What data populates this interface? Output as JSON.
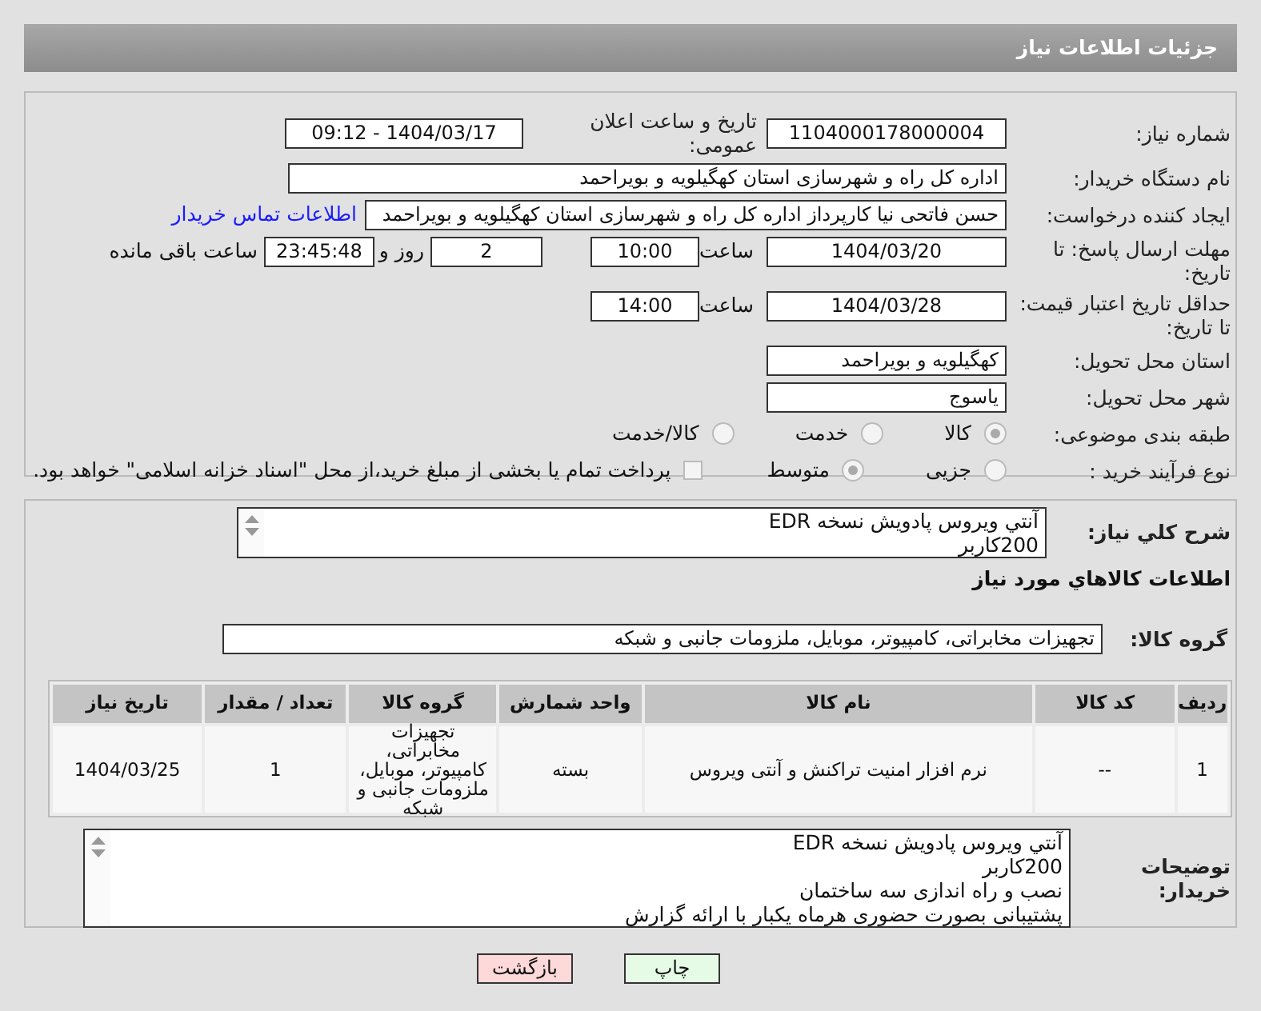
{
  "header": {
    "title": "جزئیات اطلاعات نیاز"
  },
  "need_number": {
    "label": "شماره نیاز:",
    "value": "1104000178000004"
  },
  "announce": {
    "label": "تاریخ و ساعت اعلان عمومی:",
    "value": "1404/03/17 - 09:12"
  },
  "buyer": {
    "label": "نام دستگاه خریدار:",
    "value": "اداره کل راه و شهرسازی استان کهگیلویه و بویراحمد"
  },
  "requester": {
    "label": "ایجاد کننده درخواست:",
    "value": "حسن فاتحی نیا کارپرداز اداره کل راه و شهرسازی استان کهگیلویه و بویراحمد",
    "link": "اطلاعات تماس خریدار"
  },
  "reply_deadline": {
    "label": "مهلت ارسال پاسخ: تا تاریخ:",
    "date": "1404/03/20",
    "time_label": "ساعت",
    "time": "10:00",
    "days": "2",
    "days_label": "روز و",
    "remaining": "23:45:48",
    "remaining_label": "ساعت باقی مانده"
  },
  "price_validity": {
    "label": "حداقل تاریخ اعتبار قیمت: تا تاریخ:",
    "date": "1404/03/28",
    "time_label": "ساعت",
    "time": "14:00"
  },
  "province": {
    "label": "استان محل تحویل:",
    "value": "کهگیلویه و بویراحمد"
  },
  "city": {
    "label": "شهر محل تحویل:",
    "value": "یاسوج"
  },
  "category": {
    "label": "طبقه بندی موضوعی:",
    "options": [
      {
        "label": "کالا",
        "selected": true
      },
      {
        "label": "خدمت",
        "selected": false
      },
      {
        "label": "کالا/خدمت",
        "selected": false
      }
    ]
  },
  "purchase_type": {
    "label": "نوع فرآیند خرید :",
    "options": [
      {
        "label": "جزیی",
        "selected": false
      },
      {
        "label": "متوسط",
        "selected": true
      }
    ],
    "treasury": {
      "checked": false,
      "text": "پرداخت تمام یا بخشی از مبلغ خرید،از محل \"اسناد خزانه اسلامی\" خواهد بود."
    }
  },
  "description": {
    "label": "شرح کلي نياز:",
    "lines": [
      "آنتي ويروس پادويش نسخه EDR",
      "200کاربر"
    ]
  },
  "goods_title": "اطلاعات کالاهاي مورد نياز",
  "goods_group": {
    "label": "گروه کالا:",
    "value": "تجهیزات مخابراتی، کامپیوتر، موبایل، ملزومات جانبی و شبکه"
  },
  "table": {
    "columns": [
      "ردیف",
      "کد کالا",
      "نام کالا",
      "واحد شمارش",
      "گروه کالا",
      "تعداد / مقدار",
      "تاریخ نیاز"
    ],
    "rows": [
      [
        "1",
        "--",
        "نرم افزار امنیت تراکنش و آنتی ویروس",
        "بسته",
        "تجهیزات مخابراتی، کامپیوتر، موبایل، ملزومات جانبی و شبکه",
        "1",
        "1404/03/25"
      ]
    ]
  },
  "buyer_notes": {
    "label": "توضیحات خریدار:",
    "lines": [
      "آنتي ويروس پادويش نسخه EDR",
      "200کاربر",
      "نصب و راه اندازی سه ساختمان",
      "پشتیبانی بصورت حضوری هرماه یکبار با ارائه گزارش"
    ]
  },
  "buttons": [
    {
      "label": "چاپ",
      "kind": "print"
    },
    {
      "label": "بازگشت",
      "kind": "back"
    }
  ]
}
